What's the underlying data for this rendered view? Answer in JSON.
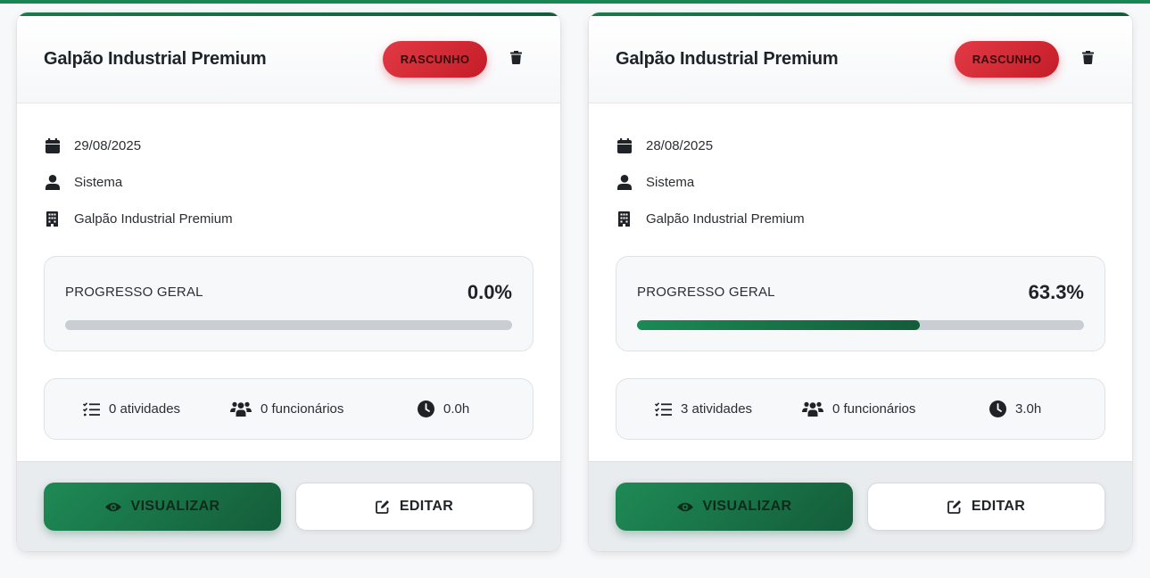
{
  "cards": [
    {
      "title": "Galpão Industrial Premium",
      "status": "RASCUNHO",
      "date": "29/08/2025",
      "user": "Sistema",
      "building": "Galpão Industrial Premium",
      "progress_label": "PROGRESSO GERAL",
      "progress_value": "0.0%",
      "progress_fraction": 0.0,
      "activities": "0 atividades",
      "employees": "0 funcionários",
      "hours": "0.0h",
      "view_label": "VISUALIZAR",
      "edit_label": "EDITAR"
    },
    {
      "title": "Galpão Industrial Premium",
      "status": "RASCUNHO",
      "date": "28/08/2025",
      "user": "Sistema",
      "building": "Galpão Industrial Premium",
      "progress_label": "PROGRESSO GERAL",
      "progress_value": "63.3%",
      "progress_fraction": 0.633,
      "activities": "3 atividades",
      "employees": "0 funcionários",
      "hours": "3.0h",
      "view_label": "VISUALIZAR",
      "edit_label": "EDITAR"
    }
  ],
  "colors": {
    "accent": "#198754",
    "status_draft": "#dc3545"
  },
  "icons": {
    "trash": "trash-icon",
    "date": "calendar-icon",
    "user": "user-icon",
    "building": "building-icon",
    "activities": "checklist-icon",
    "employees": "users-icon",
    "hours": "clock-icon",
    "view": "eye-icon",
    "edit": "edit-icon"
  }
}
